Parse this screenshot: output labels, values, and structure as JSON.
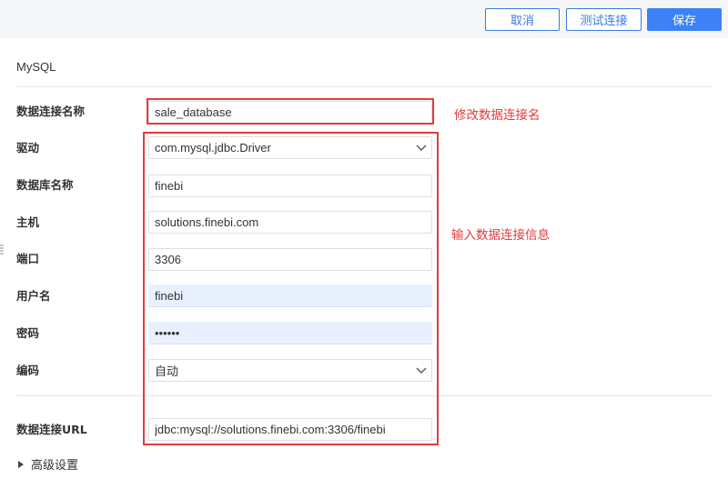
{
  "toolbar": {
    "cancel_label": "取消",
    "test_label": "测试连接",
    "save_label": "保存"
  },
  "form": {
    "db_type": "MySQL",
    "connection_name": {
      "label": "数据连接名称",
      "value": "sale_database"
    },
    "driver": {
      "label": "驱动",
      "value": "com.mysql.jdbc.Driver"
    },
    "database_name": {
      "label": "数据库名称",
      "value": "finebi"
    },
    "host": {
      "label": "主机",
      "value": "solutions.finebi.com"
    },
    "port": {
      "label": "端口",
      "value": "3306"
    },
    "username": {
      "label": "用户名",
      "value": "finebi"
    },
    "password": {
      "label": "密码",
      "value": "••••••"
    },
    "encoding": {
      "label": "编码",
      "value": "自动"
    },
    "url": {
      "label": "数据连接URL",
      "value": "jdbc:mysql://solutions.finebi.com:3306/finebi"
    },
    "advanced_label": "高级设置"
  },
  "annotations": {
    "rename": "修改数据连接名",
    "input_info": "输入数据连接信息",
    "color": "#e33b3b"
  },
  "colors": {
    "accent": "#3b82f6",
    "autofill": "#e8f0fe"
  }
}
